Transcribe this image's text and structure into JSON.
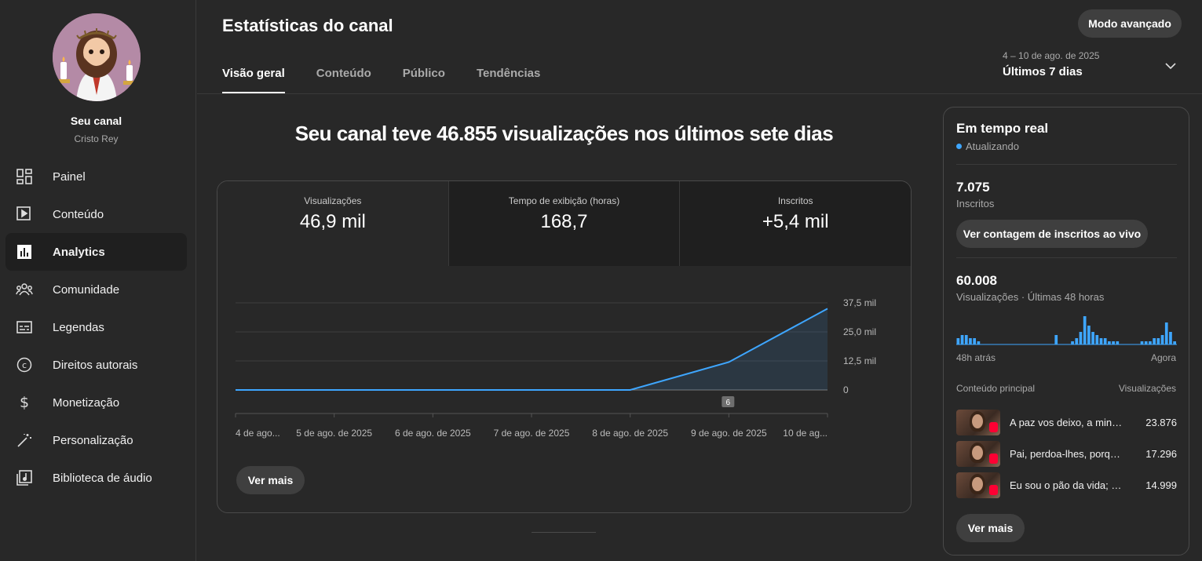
{
  "sidebar": {
    "channel_title": "Seu canal",
    "channel_name": "Cristo Rey",
    "items": [
      {
        "label": "Painel",
        "icon": "dashboard-icon"
      },
      {
        "label": "Conteúdo",
        "icon": "content-icon"
      },
      {
        "label": "Analytics",
        "icon": "analytics-icon",
        "active": true
      },
      {
        "label": "Comunidade",
        "icon": "community-icon"
      },
      {
        "label": "Legendas",
        "icon": "subtitles-icon"
      },
      {
        "label": "Direitos autorais",
        "icon": "copyright-icon"
      },
      {
        "label": "Monetização",
        "icon": "monetization-icon"
      },
      {
        "label": "Personalização",
        "icon": "customization-icon"
      },
      {
        "label": "Biblioteca de áudio",
        "icon": "audio-library-icon"
      }
    ]
  },
  "header": {
    "title": "Estatísticas do canal",
    "advanced_button": "Modo avançado",
    "tabs": [
      "Visão geral",
      "Conteúdo",
      "Público",
      "Tendências"
    ],
    "date_range": "4 – 10 de ago. de 2025",
    "date_label": "Últimos 7 dias"
  },
  "main": {
    "headline": "Seu canal teve 46.855 visualizações nos últimos sete dias",
    "metrics": [
      {
        "label": "Visualizações",
        "value": "46,9 mil"
      },
      {
        "label": "Tempo de exibição (horas)",
        "value": "168,7"
      },
      {
        "label": "Inscritos",
        "value": "+5,4 mil"
      }
    ],
    "see_more": "Ver mais"
  },
  "chart_data": {
    "type": "area",
    "x": [
      "4 de ago...",
      "5 de ago. de 2025",
      "6 de ago. de 2025",
      "7 de ago. de 2025",
      "8 de ago. de 2025",
      "9 de ago. de 2025",
      "10 de ag..."
    ],
    "series": [
      {
        "values": [
          0,
          0,
          0,
          0,
          0,
          12000,
          35000
        ]
      }
    ],
    "y_ticks": [
      "37,5 mil",
      "25,0 mil",
      "12,5 mil",
      "0"
    ],
    "ylim": [
      0,
      37500
    ],
    "marker": {
      "label": "6",
      "x_index": 5
    },
    "color": "#3ea6ff",
    "grid": true
  },
  "realtime": {
    "title": "Em tempo real",
    "status": "Atualizando",
    "subscribers_value": "7.075",
    "subscribers_label": "Inscritos",
    "live_count_button": "Ver contagem de inscritos ao vivo",
    "views_value": "60.008",
    "views_label": "Visualizações · Últimas 48 horas",
    "bar_values": [
      2,
      3,
      3,
      2,
      2,
      1,
      0,
      0,
      0,
      0,
      0,
      0,
      0,
      0,
      0,
      0,
      0,
      0,
      0,
      0,
      0,
      0,
      0,
      0,
      3,
      0,
      0,
      0,
      1,
      2,
      4,
      9,
      6,
      4,
      3,
      2,
      2,
      1,
      1,
      1,
      0,
      0,
      0,
      0,
      0,
      1,
      1,
      1,
      2,
      2,
      3,
      7,
      4,
      1
    ],
    "axis_left": "48h atrás",
    "axis_right": "Agora",
    "col_content": "Conteúdo principal",
    "col_views": "Visualizações",
    "top_content": [
      {
        "title": "A paz vos deixo, a minha paz vos dou",
        "views": "23.876"
      },
      {
        "title": "Pai, perdoa-lhes, porque não sabem o que fazem",
        "views": "17.296"
      },
      {
        "title": "Eu sou o pão da vida; quem vem a mim",
        "views": "14.999"
      }
    ],
    "see_more": "Ver mais"
  }
}
